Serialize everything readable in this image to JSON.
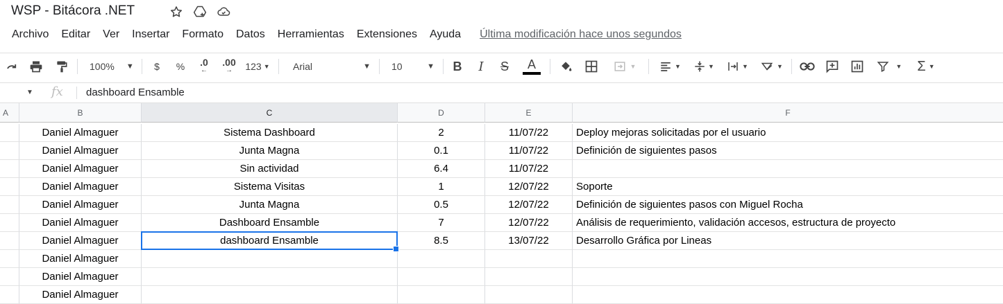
{
  "app": {
    "title": "WSP - Bitácora .NET",
    "icons": [
      "star-icon",
      "move-to-drive-icon",
      "cloud-saved-icon"
    ]
  },
  "menu": {
    "items": [
      "Archivo",
      "Editar",
      "Ver",
      "Insertar",
      "Formato",
      "Datos",
      "Herramientas",
      "Extensiones",
      "Ayuda"
    ],
    "last_edit": "Última modificación hace unos segundos"
  },
  "toolbar": {
    "zoom": "100%",
    "currency": "$",
    "percent": "%",
    "decrease_decimals": ".0",
    "increase_decimals": ".00",
    "more_formats": "123",
    "font": "Arial",
    "font_size": "10"
  },
  "formula_bar": {
    "fx": "fx",
    "value": "dashboard Ensamble"
  },
  "columns": [
    "A",
    "B",
    "C",
    "D",
    "E",
    "F"
  ],
  "rows": [
    {
      "b": "Daniel Almaguer",
      "c": "Sistema Dashboard",
      "d": "2",
      "e": "11/07/22",
      "f": "Deploy mejoras solicitadas por el usuario"
    },
    {
      "b": "Daniel Almaguer",
      "c": "Junta Magna",
      "d": "0.1",
      "e": "11/07/22",
      "f": "Definición de siguientes pasos"
    },
    {
      "b": "Daniel Almaguer",
      "c": "Sin actividad",
      "d": "6.4",
      "e": "11/07/22",
      "f": ""
    },
    {
      "b": "Daniel Almaguer",
      "c": "Sistema Visitas",
      "d": "1",
      "e": "12/07/22",
      "f": "Soporte"
    },
    {
      "b": "Daniel Almaguer",
      "c": "Junta Magna",
      "d": "0.5",
      "e": "12/07/22",
      "f": "Definición de siguientes pasos con Miguel Rocha"
    },
    {
      "b": "Daniel Almaguer",
      "c": "Dashboard Ensamble",
      "d": "7",
      "e": "12/07/22",
      "f": "Análisis de requerimiento, validación accesos,  estructura de proyecto"
    },
    {
      "b": "Daniel Almaguer",
      "c": "dashboard Ensamble",
      "d": "8.5",
      "e": "13/07/22",
      "f": "Desarrollo Gráfica por Lineas"
    },
    {
      "b": "Daniel Almaguer",
      "c": "",
      "d": "",
      "e": "",
      "f": ""
    },
    {
      "b": "Daniel Almaguer",
      "c": "",
      "d": "",
      "e": "",
      "f": ""
    },
    {
      "b": "Daniel Almaguer",
      "c": "",
      "d": "",
      "e": "",
      "f": ""
    }
  ],
  "accent_color": "#1a73e8"
}
